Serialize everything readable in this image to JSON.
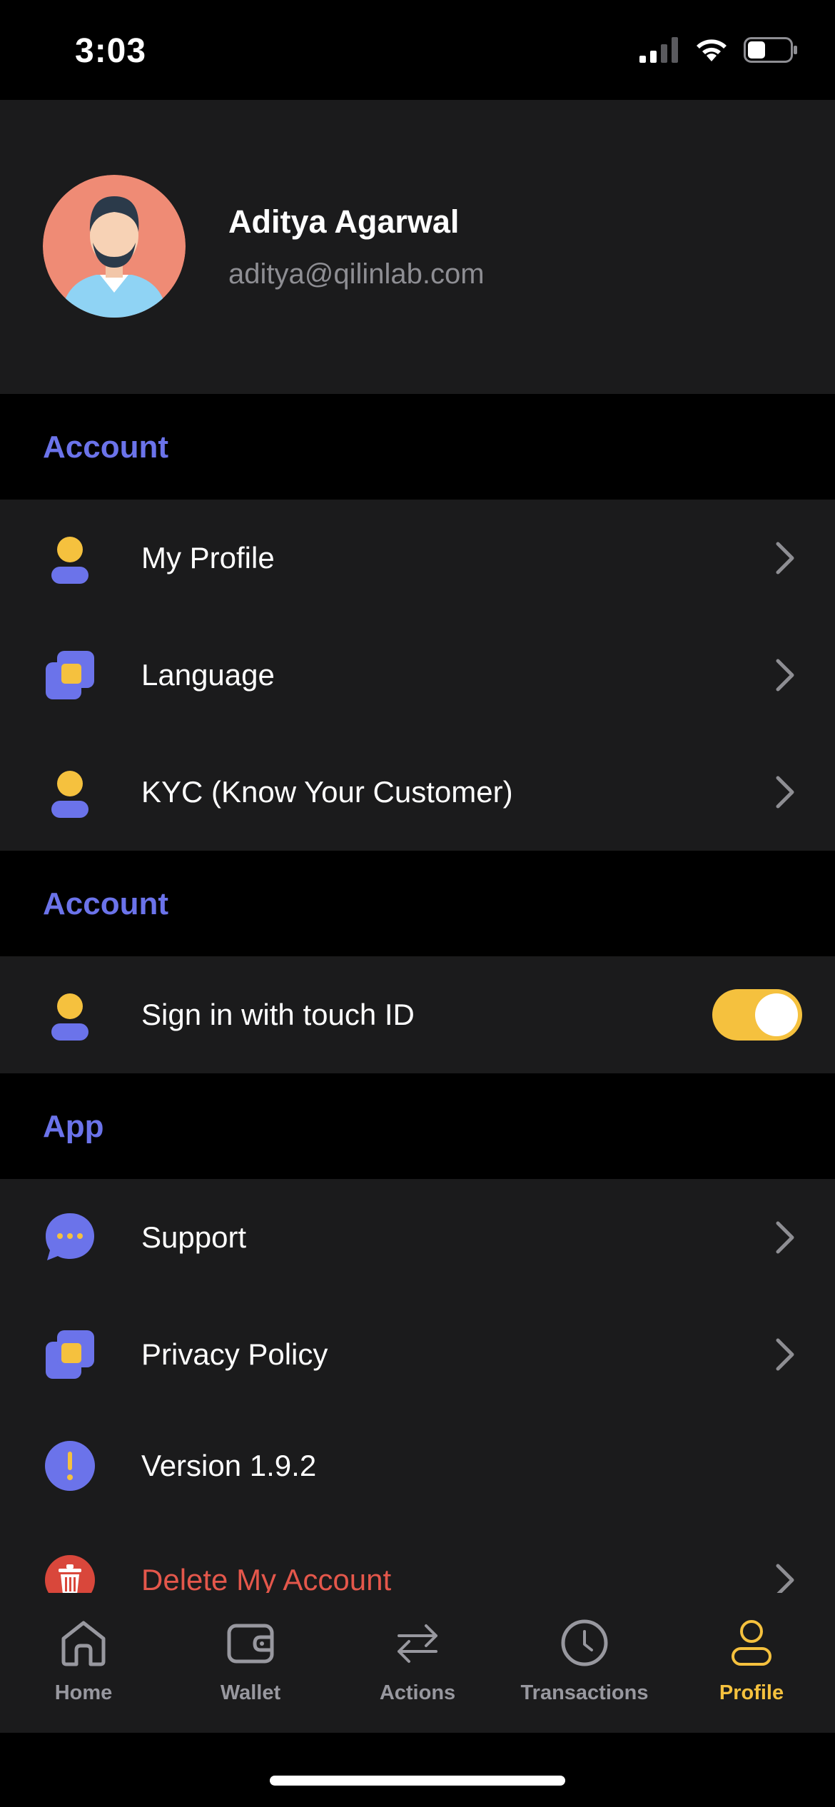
{
  "status_bar": {
    "time": "3:03",
    "icons": [
      "signal-icon",
      "wifi-icon",
      "battery-icon"
    ]
  },
  "profile": {
    "name": "Aditya Agarwal",
    "email": "aditya@qilinlab.com"
  },
  "sections": {
    "account": {
      "title": "Account",
      "items": [
        {
          "label": "My Profile",
          "icon": "user-icon"
        },
        {
          "label": "Language",
          "icon": "layers-icon"
        },
        {
          "label": "KYC (Know Your Customer)",
          "icon": "user-icon"
        }
      ]
    },
    "security": {
      "title": "Account",
      "items": [
        {
          "label": "Sign in with touch ID",
          "icon": "user-icon",
          "toggle_on": true
        }
      ]
    },
    "app": {
      "title": "App",
      "items": [
        {
          "label": "Support",
          "icon": "chat-bubble-icon"
        },
        {
          "label": "Privacy Policy",
          "icon": "layers-icon"
        },
        {
          "label": "Version 1.9.2",
          "icon": "info-icon"
        },
        {
          "label": "Delete My Account",
          "icon": "trash-icon"
        }
      ]
    }
  },
  "tab_bar": {
    "tabs": [
      {
        "label": "Home",
        "icon": "home-icon"
      },
      {
        "label": "Wallet",
        "icon": "wallet-icon"
      },
      {
        "label": "Actions",
        "icon": "transfer-arrows-icon"
      },
      {
        "label": "Transactions",
        "icon": "clock-icon"
      },
      {
        "label": "Profile",
        "icon": "profile-icon",
        "active": true
      }
    ]
  },
  "colors": {
    "accent_blue": "#6b73ea",
    "accent_yellow": "#f5c13e",
    "danger": "#e4574b",
    "surface": "#1b1b1c",
    "background": "#000000"
  }
}
